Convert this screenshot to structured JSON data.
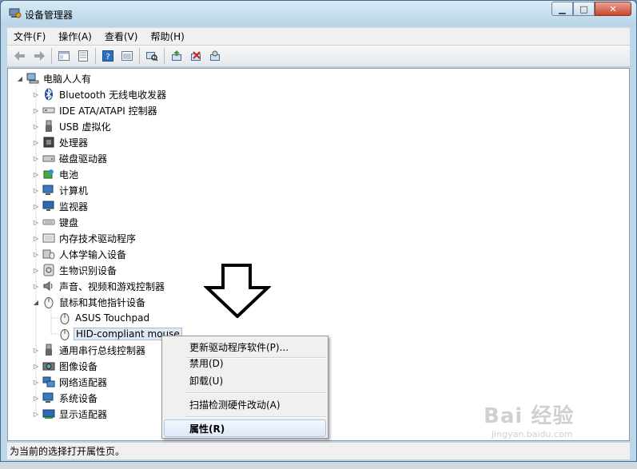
{
  "window": {
    "title": "设备管理器"
  },
  "menubar": {
    "items": [
      "文件(F)",
      "操作(A)",
      "查看(V)",
      "帮助(H)"
    ]
  },
  "toolbar": {
    "icons": [
      "back-icon",
      "forward-icon",
      "properties-window-icon",
      "list-icon",
      "help-icon",
      "view-icon",
      "scan-icon",
      "update-driver-icon",
      "disable-icon",
      "uninstall-icon"
    ]
  },
  "tree": {
    "root": "电脑人人有",
    "items": [
      {
        "label": "Bluetooth 无线电收发器"
      },
      {
        "label": "IDE ATA/ATAPI 控制器"
      },
      {
        "label": "USB 虚拟化"
      },
      {
        "label": "处理器"
      },
      {
        "label": "磁盘驱动器"
      },
      {
        "label": "电池"
      },
      {
        "label": "计算机"
      },
      {
        "label": "监视器"
      },
      {
        "label": "键盘"
      },
      {
        "label": "内存技术驱动程序"
      },
      {
        "label": "人体学输入设备"
      },
      {
        "label": "生物识别设备"
      },
      {
        "label": "声音、视频和游戏控制器"
      },
      {
        "label": "鼠标和其他指针设备"
      },
      {
        "label": "ASUS Touchpad"
      },
      {
        "label": "HID-compliant mouse"
      },
      {
        "label": "通用串行总线控制器"
      },
      {
        "label": "图像设备"
      },
      {
        "label": "网络适配器"
      },
      {
        "label": "系统设备"
      },
      {
        "label": "显示适配器"
      }
    ]
  },
  "context_menu": {
    "items": [
      "更新驱动程序软件(P)...",
      "禁用(D)",
      "卸载(U)",
      "扫描检测硬件改动(A)",
      "属性(R)"
    ]
  },
  "statusbar": {
    "text": "为当前的选择打开属性页。"
  },
  "watermark": {
    "text": "Bai 经验",
    "sub": "jingyan.baidu.com"
  },
  "colors": {
    "accent": "#3399ff",
    "titlebar": "#bcd7ea",
    "close": "#c9462c"
  }
}
